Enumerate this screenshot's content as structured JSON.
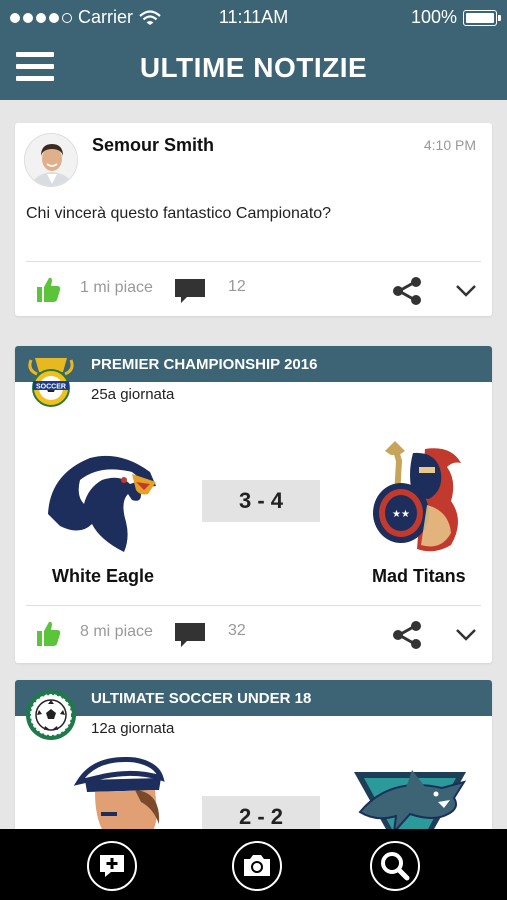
{
  "status": {
    "carrier": "Carrier",
    "time": "11:11AM",
    "battery": "100%"
  },
  "header": {
    "title": "ULTIME NOTIZIE"
  },
  "post": {
    "author": "Semour Smith",
    "time": "4:10 PM",
    "text": "Chi vincerà questo fantastico Campionato?",
    "likes": "1 mi piace",
    "comments": "12"
  },
  "matches": [
    {
      "league": "PREMIER CHAMPIONSHIP 2016",
      "round": "25a giornata",
      "home": "White Eagle",
      "away": "Mad Titans",
      "score": "3 - 4",
      "likes": "8 mi piace",
      "comments": "32"
    },
    {
      "league": "ULTIMATE SOCCER UNDER 18",
      "round": "12a giornata",
      "score": "2 - 2"
    }
  ],
  "colors": {
    "primary": "#3d6475",
    "like": "#5cc43a",
    "background": "#e6e6e6"
  }
}
